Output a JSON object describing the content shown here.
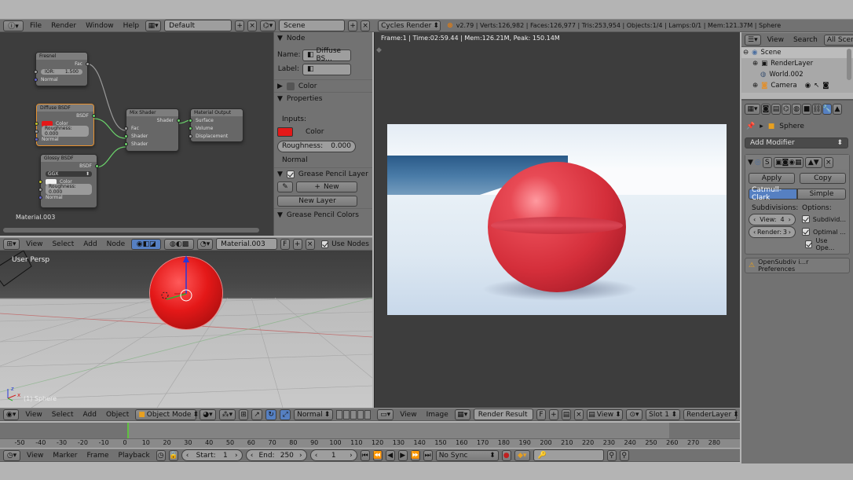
{
  "top_bar": {
    "menus": [
      "File",
      "Render",
      "Window",
      "Help"
    ],
    "layout_value": "Default",
    "scene_value": "Scene",
    "render_engine": "Cycles Render",
    "stats": "v2.79 | Verts:126,982 | Faces:126,977 | Tris:253,954 | Objects:1/4 | Lamps:0/1 | Mem:121.37M | Sphere"
  },
  "node_editor": {
    "nodes": {
      "fresnel": {
        "title": "Fresnel",
        "out": "Fac",
        "ior_label": "IOR:",
        "ior_value": "1.500",
        "normal": "Normal"
      },
      "diffuse": {
        "title": "Diffuse BSDF",
        "out": "BSDF",
        "color": "Color",
        "roughness": "Roughness: 0.000",
        "normal": "Normal"
      },
      "glossy": {
        "title": "Glossy BSDF",
        "out": "BSDF",
        "distribution": "GGX",
        "color": "Color",
        "roughness": "Roughness: 0.000",
        "normal": "Normal"
      },
      "mix": {
        "title": "Mix Shader",
        "out": "Shader",
        "fac": "Fac",
        "shader1": "Shader",
        "shader2": "Shader"
      },
      "output": {
        "title": "Material Output",
        "surface": "Surface",
        "volume": "Volume",
        "displacement": "Displacement"
      }
    },
    "material_label": "Material.003",
    "header": {
      "menus": [
        "View",
        "Select",
        "Add",
        "Node"
      ],
      "material": "Material.003",
      "f_label": "F",
      "use_nodes": "Use Nodes"
    }
  },
  "n_panel": {
    "node_section": "Node",
    "name_label": "Name:",
    "name_value": "Diffuse BS...",
    "label_label": "Label:",
    "color_section": "Color",
    "properties_section": "Properties",
    "inputs_label": "Inputs:",
    "color_label": "Color",
    "roughness_label": "Roughness:",
    "roughness_value": "0.000",
    "normal_label": "Normal",
    "gp_layer_section": "Grease Pencil Layer",
    "new_label": "New",
    "new_layer_label": "New Layer",
    "gp_colors_section": "Grease Pencil Colors"
  },
  "viewport_3d": {
    "label": "User Persp",
    "object_label": "(1) Sphere",
    "header": {
      "menus": [
        "View",
        "Select",
        "Add",
        "Object"
      ],
      "mode": "Object Mode",
      "orientation": "Normal"
    }
  },
  "image_editor": {
    "info": "Frame:1 | Time:02:59.44 | Mem:126.21M, Peak: 150.14M",
    "header": {
      "menus": [
        "View",
        "Image"
      ],
      "image_name": "Render Result",
      "f_label": "F",
      "view_label": "View",
      "slot": "Slot 1",
      "layer": "RenderLayer"
    }
  },
  "outliner": {
    "header": {
      "view": "View",
      "search": "Search",
      "all_scenes": "All Scenes"
    },
    "items": [
      "Scene",
      "RenderLayer",
      "World.002",
      "Camera"
    ]
  },
  "properties": {
    "object_name": "Sphere",
    "add_modifier": "Add Modifier",
    "modifier_s": "S",
    "apply": "Apply",
    "copy": "Copy",
    "catmull_clark": "Catmull-Clark",
    "simple": "Simple",
    "subdivisions_label": "Subdivisions:",
    "options_label": "Options:",
    "view_label": "View:",
    "view_value": "4",
    "render_label": "Render:",
    "render_value": "3",
    "opt1": "Subdivid...",
    "opt2": "Optimal ...",
    "opt3": "Use Ope...",
    "warning": "OpenSubdiv i...r Preferences"
  },
  "timeline": {
    "ticks": [
      "-50",
      "-40",
      "-30",
      "-20",
      "-10",
      "0",
      "10",
      "20",
      "30",
      "40",
      "50",
      "60",
      "70",
      "80",
      "90",
      "100",
      "110",
      "120",
      "130",
      "140",
      "150",
      "160",
      "170",
      "180",
      "190",
      "200",
      "210",
      "220",
      "230",
      "240",
      "250",
      "260",
      "270",
      "280"
    ],
    "header": {
      "menus": [
        "View",
        "Marker",
        "Frame",
        "Playback"
      ],
      "start_label": "Start:",
      "start_value": "1",
      "end_label": "End:",
      "end_value": "250",
      "current": "1",
      "sync": "No Sync"
    }
  },
  "colors": {
    "diffuse_red": "#e41818",
    "sphere_red": "#d4303a",
    "accent_blue": "#5680c2"
  }
}
